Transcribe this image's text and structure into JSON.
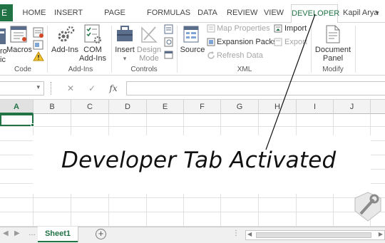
{
  "tabs": {
    "file": "E",
    "home": "HOME",
    "insert": "INSERT",
    "page_layout": "PAGE LAYOUT",
    "formulas": "FORMULAS",
    "data": "DATA",
    "review": "REVIEW",
    "view": "VIEW",
    "developer": "DEVELOPER",
    "user": "Kapil Arya"
  },
  "ribbon": {
    "code": {
      "partial_top": "ro",
      "partial_bottom": "ic",
      "macros": "Macros",
      "label": "Code"
    },
    "addins": {
      "addins": "Add-Ins",
      "com_line1": "COM",
      "com_line2": "Add-Ins",
      "label": "Add-Ins"
    },
    "controls": {
      "insert": "Insert",
      "design_line1": "Design",
      "design_line2": "Mode",
      "label": "Controls"
    },
    "xml": {
      "source": "Source",
      "map_properties": "Map Properties",
      "expansion_packs": "Expansion Packs",
      "refresh_data": "Refresh Data",
      "import": "Import",
      "export": "Export",
      "label": "XML"
    },
    "modify": {
      "doc_line1": "Document",
      "doc_line2": "Panel",
      "label": "Modify"
    }
  },
  "formula_bar": {
    "cancel": "✕",
    "enter": "✓",
    "fx": "fx"
  },
  "columns": [
    "A",
    "B",
    "C",
    "D",
    "E",
    "F",
    "G",
    "H",
    "I",
    "J"
  ],
  "caption": "Developer Tab Activated",
  "sheets": [
    "Sheet1"
  ],
  "colors": {
    "accent": "#217346",
    "caption_text": "#111111"
  }
}
